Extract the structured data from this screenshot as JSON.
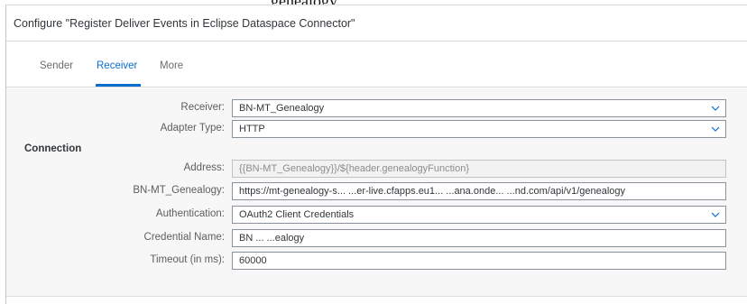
{
  "top_caption": "genealogy",
  "dialog": {
    "title": "Configure \"Register Deliver Events in Eclipse Dataspace Connector\""
  },
  "tabs": [
    {
      "label": "Sender"
    },
    {
      "label": "Receiver"
    },
    {
      "label": "More"
    }
  ],
  "active_tab": "Receiver",
  "form": {
    "section_label": "Connection",
    "receiver": {
      "label": "Receiver:",
      "value": "BN-MT_Genealogy"
    },
    "adapter_type": {
      "label": "Adapter Type:",
      "value": "HTTP"
    },
    "address": {
      "label": "Address:",
      "value": "{{BN-MT_Genealogy}}/${header.genealogyFunction}"
    },
    "bn_mt_genealogy": {
      "label": "BN-MT_Genealogy:",
      "value": "https://mt-genealogy-s... ...er-live.cfapps.eu1... ...ana.onde... ...nd.com/api/v1/genealogy"
    },
    "authentication": {
      "label": "Authentication:",
      "value": "OAuth2 Client Credentials"
    },
    "credential_name": {
      "label": "Credential Name:",
      "value": "BN ... ...ealogy"
    },
    "timeout": {
      "label": "Timeout (in ms):",
      "value": "60000"
    }
  },
  "colors": {
    "accent": "#0a6ed1",
    "content_bg": "#f7f7f7",
    "field_border": "#89919a"
  },
  "icons": {
    "dropdown": "chevron-down-icon"
  }
}
